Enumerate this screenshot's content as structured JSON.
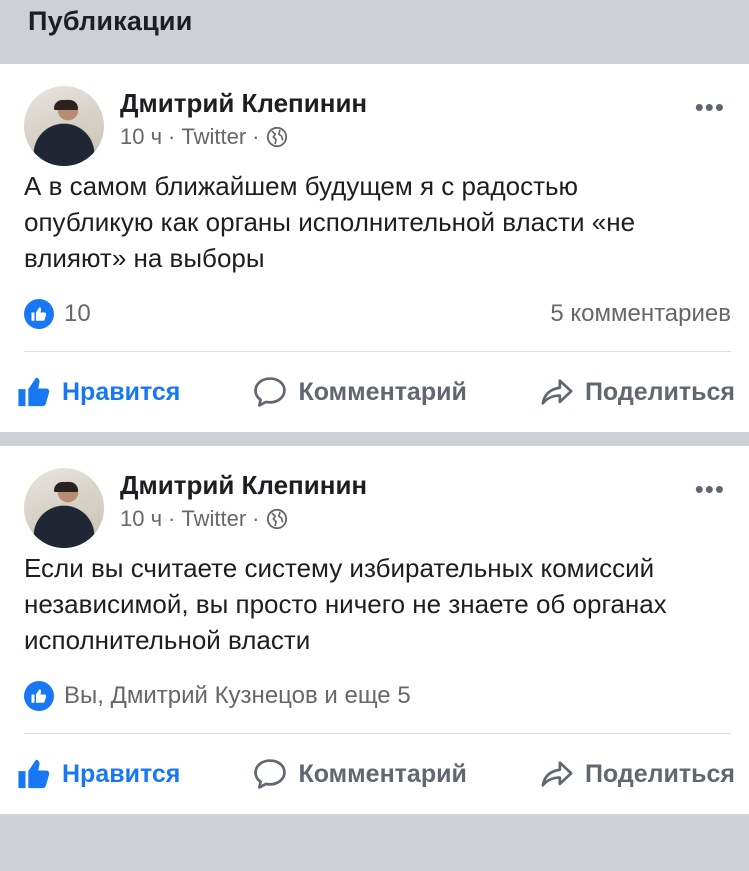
{
  "section": {
    "title": "Публикации"
  },
  "posts": [
    {
      "author": "Дмитрий Клепинин",
      "time": "10 ч",
      "source": "Twitter",
      "separator": "·",
      "text": "А в самом ближайшем будущем я с радостью опубликую как органы исполнительной власти «не влияют» на выборы",
      "reactions_text": "10",
      "comments_text": "5 комментариев",
      "actions": {
        "like": "Нравится",
        "comment": "Комментарий",
        "share": "Поделиться"
      }
    },
    {
      "author": "Дмитрий Клепинин",
      "time": "10 ч",
      "source": "Twitter",
      "separator": "·",
      "text": "Если вы считаете систему избирательных комиссий независимой, вы просто ничего не знаете об органах исполнительной власти",
      "reactions_text": "Вы, Дмитрий Кузнецов и еще 5",
      "comments_text": "",
      "actions": {
        "like": "Нравится",
        "comment": "Комментарий",
        "share": "Поделиться"
      }
    }
  ],
  "colors": {
    "accent": "#1877f2",
    "muted": "#65676b",
    "background": "#cdd0d5"
  },
  "icons": [
    "globe-icon",
    "more-icon",
    "like-badge-icon",
    "thumbs-up-icon",
    "comment-icon",
    "share-icon"
  ]
}
